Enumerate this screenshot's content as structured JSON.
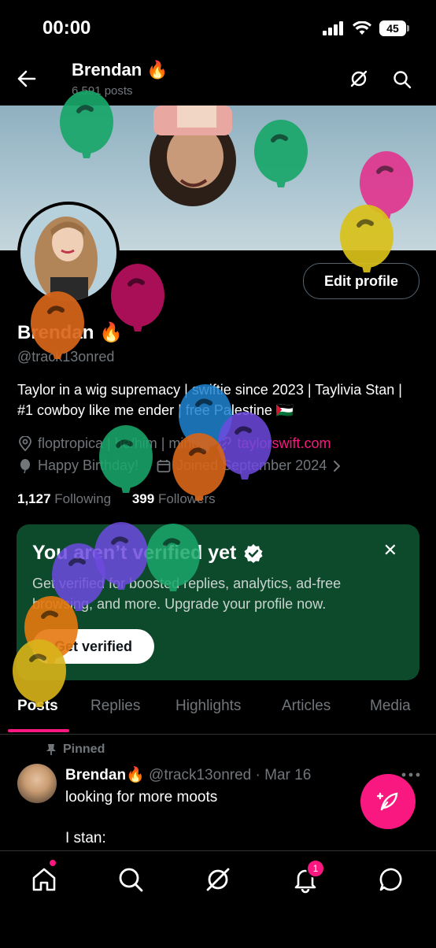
{
  "status_bar": {
    "time": "00:00",
    "battery": "45"
  },
  "header": {
    "name": "Brendan",
    "posts_count": "6,591 posts"
  },
  "profile": {
    "name": "Brendan",
    "handle": "@track13onred",
    "edit_button": "Edit profile",
    "bio": "Taylor in a wig supremacy | swiftie since 2023 | Taylivia Stan | #1 cowboy like me ender | free Palestine 🇵🇸",
    "location": "floptropica | he/him | minor",
    "website": "taylorswift.com",
    "birthday": "Happy Birthday!",
    "joined": "Joined September 2024",
    "following_count": "1,127",
    "following_label": "Following",
    "followers_count": "399",
    "followers_label": "Followers"
  },
  "verify_card": {
    "title": "You aren’t verified yet",
    "text": "Get verified for boosted replies, analytics, ad-free browsing, and more. Upgrade your profile now.",
    "button": "Get verified"
  },
  "tabs": [
    "Posts",
    "Replies",
    "Highlights",
    "Articles",
    "Media"
  ],
  "pinned_post": {
    "pinned_label": "Pinned",
    "author": "Brendan",
    "handle": "@track13onred",
    "date": "· Mar 16",
    "line1": "looking for more moots",
    "line2": "I stan:"
  },
  "notifications_badge": "1",
  "colors": {
    "accent": "#f91880",
    "verify_card": "#0d4a2c",
    "muted": "#71767b"
  }
}
